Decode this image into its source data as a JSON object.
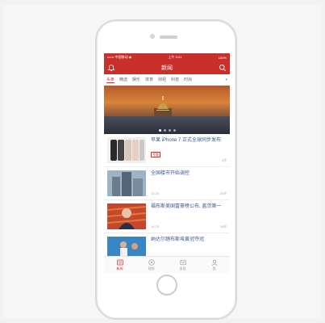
{
  "status": {
    "carrier": "•••••• 中国移动 ◉",
    "time": "上午 9:41",
    "battery": "100%"
  },
  "navbar": {
    "title": "新闻"
  },
  "tabs": [
    "头条",
    "精选",
    "娱乐",
    "体育",
    "财经",
    "科技",
    "时尚"
  ],
  "news": [
    {
      "title": "苹果 iPhone 7 正式全球同步发布",
      "badge": "专题",
      "time": "",
      "comments": "1评"
    },
    {
      "title": "全国楼市开始调控",
      "time": "14:25",
      "comments": "20评"
    },
    {
      "title": "福布斯美国富豪榜公布, 盖茨第一",
      "time": "14:25",
      "comments": "34评"
    },
    {
      "title": "纳达尔踏布斯埃黄冠夺冠",
      "time": "",
      "comments": ""
    }
  ],
  "bottom_tabs": [
    {
      "label": "新闻",
      "icon": "news-icon"
    },
    {
      "label": "视频",
      "icon": "video-icon"
    },
    {
      "label": "发现",
      "icon": "discover-icon"
    },
    {
      "label": "我",
      "icon": "profile-icon"
    }
  ],
  "colors": {
    "brand": "#c9302c"
  }
}
